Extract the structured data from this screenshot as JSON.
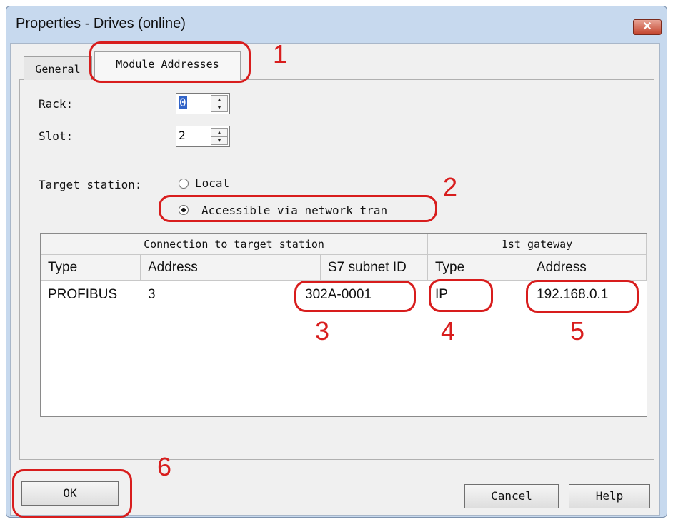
{
  "window": {
    "title": "Properties - Drives (online)",
    "close_glyph": "✕"
  },
  "tabs": [
    {
      "label": "General"
    },
    {
      "label": "Module Addresses"
    }
  ],
  "fields": {
    "rack_label": "Rack:",
    "rack_value": "0",
    "slot_label": "Slot:",
    "slot_value": "2",
    "target_station_label": "Target station:",
    "local_label": "Local",
    "network_label": "Accessible via network tran"
  },
  "table": {
    "group_headers": [
      "Connection to target station",
      "1st gateway"
    ],
    "columns": [
      "Type",
      "Address",
      "S7 subnet ID",
      "Type",
      "Address"
    ],
    "rows": [
      [
        "PROFIBUS",
        "3",
        "302A-0001",
        "IP",
        "192.168.0.1"
      ]
    ]
  },
  "buttons": {
    "ok": "OK",
    "cancel": "Cancel",
    "help": "Help"
  },
  "annotations": [
    "1",
    "2",
    "3",
    "4",
    "5",
    "6"
  ],
  "colors": {
    "annotation": "#d81d1d",
    "title_bar": "#c7d9ee",
    "dialog": "#f0f0f0"
  },
  "icons": {
    "spin_up": "▲",
    "spin_down": "▼"
  }
}
